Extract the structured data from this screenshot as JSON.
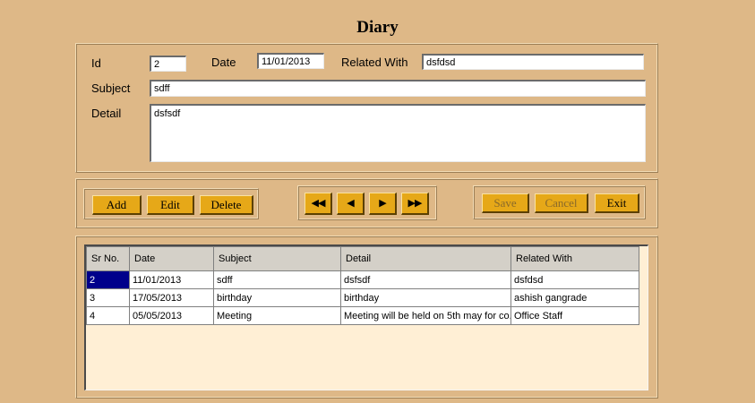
{
  "window": {
    "title": "Diary"
  },
  "form": {
    "id_label": "Id",
    "id_value": "2",
    "date_label": "Date",
    "date_value": "11/01/2013",
    "related_label": "Related With",
    "related_value": "dsfdsd",
    "subject_label": "Subject",
    "subject_value": "sdff",
    "detail_label": "Detail",
    "detail_value": "dsfsdf"
  },
  "buttons": {
    "add": "Add",
    "edit": "Edit",
    "delete": "Delete",
    "first": "◀◀",
    "prev": "◀",
    "next": "▶",
    "last": "▶▶",
    "save": "Save",
    "cancel": "Cancel",
    "exit": "Exit"
  },
  "grid": {
    "columns": [
      "Sr No.",
      "Date",
      "Subject",
      "Detail",
      "Related With"
    ],
    "rows": [
      [
        "2",
        "11/01/2013",
        "sdff",
        "dsfsdf",
        "dsfdsd"
      ],
      [
        "3",
        "17/05/2013",
        "birthday",
        "birthday",
        "ashish gangrade"
      ],
      [
        "4",
        "05/05/2013",
        "Meeting",
        "Meeting will be held on 5th may for co...",
        "Office Staff"
      ]
    ],
    "selected_row": 0
  },
  "colors": {
    "background": "#DEB887",
    "button": "#E6A818",
    "grid_background": "#FFEFD5",
    "selection": "#00008B"
  }
}
